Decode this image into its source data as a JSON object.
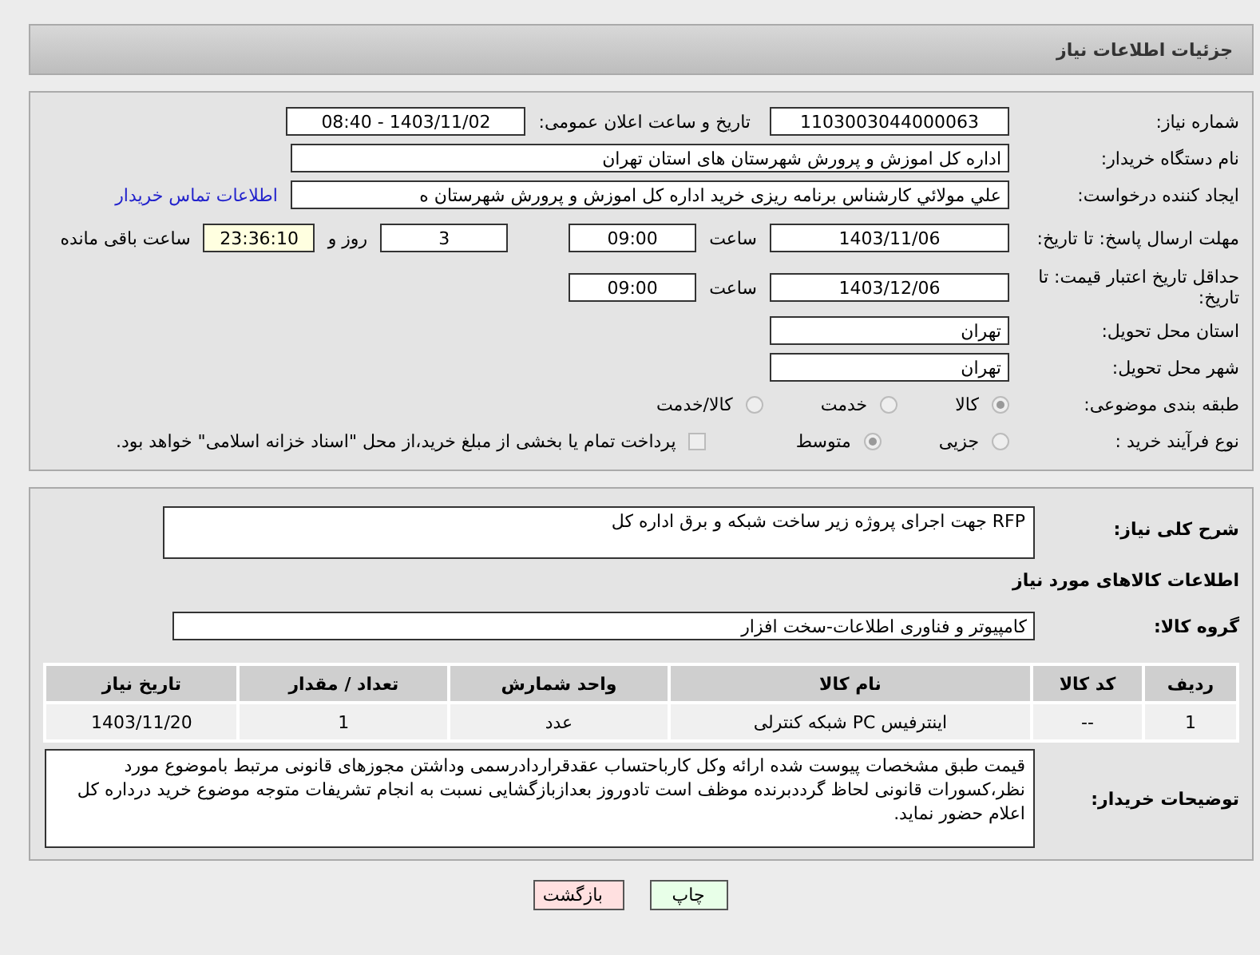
{
  "header": {
    "title": "جزئیات اطلاعات نیاز"
  },
  "need_number": {
    "label": "شماره نیاز:",
    "value": "1103003044000063"
  },
  "announce": {
    "label": "تاریخ و ساعت اعلان عمومی:",
    "value": "1403/11/02 - 08:40"
  },
  "buyer": {
    "label": "نام دستگاه خریدار:",
    "value": "اداره کل اموزش و پرورش شهرستان های استان تهران"
  },
  "requester": {
    "label": "ایجاد کننده درخواست:",
    "value": "علي مولائي کارشناس برنامه ریزی خرید  اداره کل اموزش و پرورش شهرستان ه",
    "link": "اطلاعات تماس خریدار"
  },
  "deadline": {
    "label": "مهلت ارسال پاسخ: تا تاریخ:",
    "date": "1403/11/06",
    "time_label": "ساعت",
    "time": "09:00",
    "days": "3",
    "days_label": "روز و",
    "remaining": "23:36:10",
    "remaining_label": "ساعت باقی مانده"
  },
  "validity": {
    "label": "حداقل تاریخ اعتبار قیمت: تا تاریخ:",
    "date": "1403/12/06",
    "time_label": "ساعت",
    "time": "09:00"
  },
  "province": {
    "label": "استان محل تحویل:",
    "value": "تهران"
  },
  "city": {
    "label": "شهر محل تحویل:",
    "value": "تهران"
  },
  "category": {
    "label": "طبقه بندی موضوعی:",
    "options": [
      {
        "label": "کالا",
        "selected": true
      },
      {
        "label": "خدمت",
        "selected": false
      },
      {
        "label": "کالا/خدمت",
        "selected": false
      }
    ]
  },
  "process": {
    "label": "نوع فرآیند خرید :",
    "options": [
      {
        "label": "جزیی",
        "selected": false
      },
      {
        "label": "متوسط",
        "selected": true
      }
    ],
    "payment": {
      "checked": false,
      "text": "پرداخت تمام یا بخشی از مبلغ خرید،از محل \"اسناد خزانه اسلامی\" خواهد بود."
    }
  },
  "description": {
    "label": "شرح کلی نیاز:",
    "value": "RFP جهت اجرای پروژه زیر ساخت شبکه و برق اداره کل"
  },
  "goods_title": "اطلاعات کالاهای مورد نیاز",
  "group": {
    "label": "گروه کالا:",
    "value": "کامپیوتر و فناوری اطلاعات-سخت افزار"
  },
  "table": {
    "columns": [
      "ردیف",
      "کد کالا",
      "نام کالا",
      "واحد شمارش",
      "تعداد / مقدار",
      "تاریخ نیاز"
    ],
    "rows": [
      [
        "1",
        "--",
        "اینترفیس PC شبکه کنترلی",
        "عدد",
        "1",
        "1403/11/20"
      ]
    ]
  },
  "buyer_notes": {
    "label": "توضیحات خریدار:",
    "value": "قیمت طبق مشخصات پیوست شده ارائه وکل کارباحتساب عقدقراردادرسمی وداشتن مجوزهای قانونی مرتبط باموضوع مورد نظر،کسورات قانونی لحاظ گرددبرنده موظف است تادوروز بعدازبازگشایی نسبت به انجام تشریفات متوجه موضوع خرید درداره کل اعلام حضور نماید."
  },
  "buttons": [
    {
      "label": "چاپ",
      "kind": "print"
    },
    {
      "label": "بازگشت",
      "kind": "back"
    }
  ]
}
